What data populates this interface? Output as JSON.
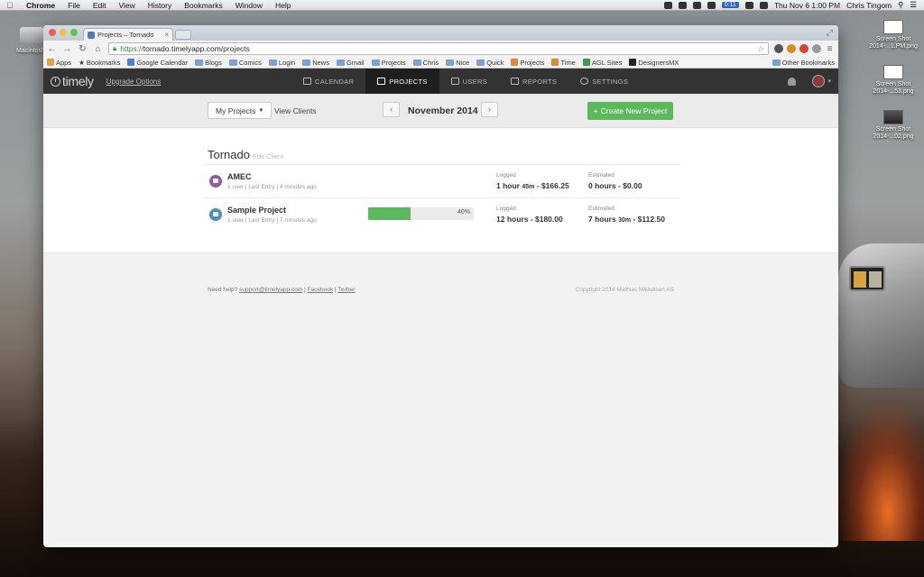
{
  "menubar": {
    "app": "Chrome",
    "items": [
      "File",
      "Edit",
      "View",
      "History",
      "Bookmarks",
      "Window",
      "Help"
    ],
    "battery": "0:11",
    "clock": "Thu Nov 6  1:00 PM",
    "user": "Chris Tingom"
  },
  "desktop": {
    "hdd_label": "Macintosh",
    "icons": [
      {
        "line1": "Screen Shot",
        "line2": "2014-...1.PM.png"
      },
      {
        "line1": "Screen Shot",
        "line2": "2014-...53.png"
      },
      {
        "line1": "Screen Shot",
        "line2": "2014-...02.png"
      }
    ]
  },
  "browser": {
    "tab_title": "Projects – Tornado",
    "url_scheme": "https://",
    "url_host": "tornado.timelyapp.com",
    "url_path": "/projects",
    "bookmarks": [
      "Apps",
      "Bookmarks",
      "Google Calendar",
      "Blogs",
      "Comics",
      "Login",
      "News",
      "Gmail",
      "Projects",
      "Chris",
      "Nice",
      "Quick",
      "Projects",
      "Time",
      "AGL Sites",
      "DesignersMX"
    ],
    "other_bookmarks": "Other Bookmarks"
  },
  "app": {
    "logo": "timely",
    "upgrade": "Upgrade Options",
    "nav": [
      {
        "label": "CALENDAR"
      },
      {
        "label": "PROJECTS"
      },
      {
        "label": "USERS"
      },
      {
        "label": "REPORTS"
      },
      {
        "label": "SETTINGS"
      }
    ],
    "toolbar": {
      "my_projects": "My Projects",
      "view_clients": "View Clients",
      "month": "November 2014",
      "create_button": "Create New Project"
    },
    "client": {
      "name": "Tornado",
      "edit": "Edit Client"
    },
    "projects": [
      {
        "name": "AMEC",
        "meta": "1 user | Last Entry | 4 minutes ago",
        "color": "#8e5ea2",
        "progress": null,
        "logged_label": "Logged",
        "logged_main": "1 hour",
        "logged_small": "45m",
        "logged_rest": "- $166.25",
        "estimated_label": "Estimated",
        "estimated_main": "0 hours",
        "estimated_small": "",
        "estimated_rest": "- $0.00"
      },
      {
        "name": "Sample Project",
        "meta": "1 user | Last Entry | 7 minutes ago",
        "color": "#4a90c2",
        "progress": 40,
        "progress_text": "40%",
        "logged_label": "Logged",
        "logged_main": "12 hours",
        "logged_small": "",
        "logged_rest": "- $180.00",
        "estimated_label": "Estimated",
        "estimated_main": "7 hours",
        "estimated_small": "30m",
        "estimated_rest": "- $112.50"
      }
    ],
    "footer": {
      "help": "Need help?",
      "email": "support@timelyapp.com",
      "facebook": "Facebook",
      "twitter": "Twitter",
      "copyright": "Copyright 2014 Mathias Mikkelsen AS"
    }
  }
}
